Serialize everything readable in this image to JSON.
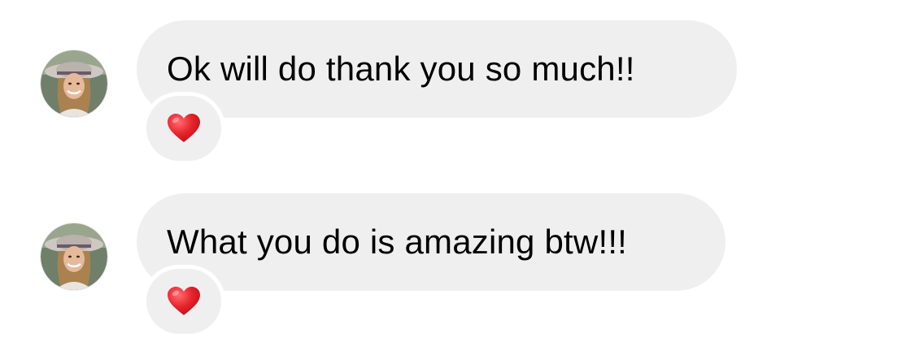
{
  "conversation": {
    "messages": [
      {
        "sender_avatar": "user-avatar-icon",
        "text": "Ok will do thank you so much!!",
        "reaction": "red-heart-icon"
      },
      {
        "sender_avatar": "user-avatar-icon",
        "text": "What you do is amazing btw!!!",
        "reaction": "red-heart-icon"
      }
    ]
  },
  "colors": {
    "bubble_background": "#efefef",
    "page_background": "#ffffff",
    "heart": "#e8232b",
    "text": "#000000"
  }
}
